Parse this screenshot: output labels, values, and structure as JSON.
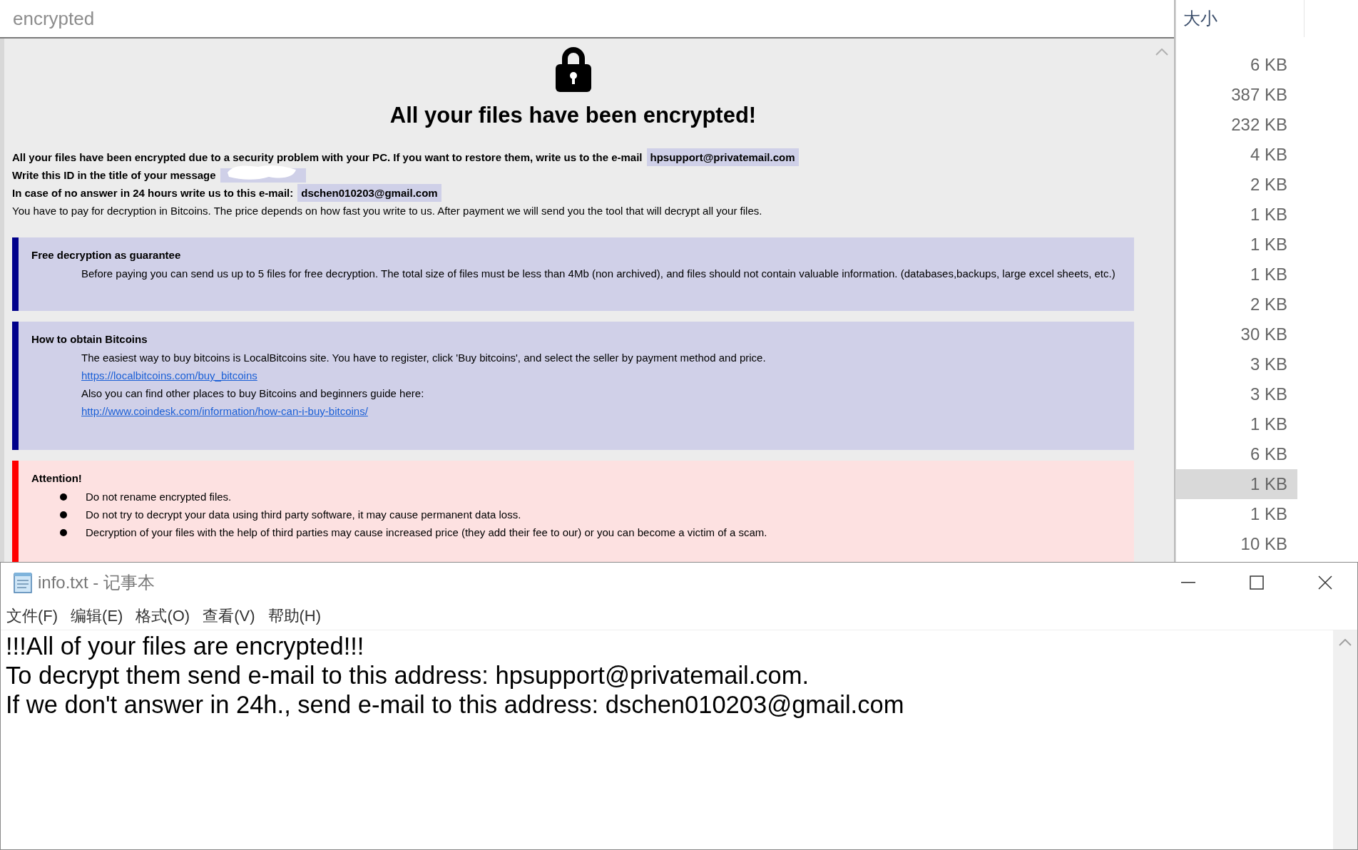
{
  "search": {
    "value": "encrypted"
  },
  "note": {
    "title": "All your files have been encrypted!",
    "intro": [
      {
        "text": "All your files have been encrypted due to a security problem with your PC. If you want to restore them, write us to the e-mail",
        "highlight": "hpsupport@privatemail.com",
        "bold": true
      },
      {
        "text": "Write this ID in the title of your message",
        "redacted": true,
        "bold": true
      },
      {
        "text": "In case of no answer in 24 hours write us to this e-mail:",
        "highlight": "dschen010203@gmail.com",
        "bold": true
      },
      {
        "text": "You have to pay for decryption in Bitcoins. The price depends on how fast you write to us. After payment we will send you the tool that will decrypt all your files.",
        "bold": false
      }
    ],
    "sections": [
      {
        "kind": "info",
        "heading": "Free decryption as guarantee",
        "lines": [
          {
            "kind": "text",
            "text": "Before paying you can send us up to 5 files for free decryption. The total size of files must be less than 4Mb (non archived), and files should not contain valuable information. (databases,backups, large excel sheets, etc.)"
          }
        ]
      },
      {
        "kind": "info",
        "heading": "How to obtain Bitcoins",
        "lines": [
          {
            "kind": "text",
            "text": "The easiest way to buy bitcoins is LocalBitcoins site. You have to register, click 'Buy bitcoins', and select the seller by payment method and price."
          },
          {
            "kind": "link",
            "text": "https://localbitcoins.com/buy_bitcoins"
          },
          {
            "kind": "text",
            "text": "Also you can find other places to buy Bitcoins and beginners guide here:"
          },
          {
            "kind": "link",
            "text": "http://www.coindesk.com/information/how-can-i-buy-bitcoins/"
          }
        ]
      },
      {
        "kind": "warning",
        "heading": "Attention!",
        "lines": [
          {
            "kind": "bullet",
            "text": "Do not rename encrypted files."
          },
          {
            "kind": "bullet",
            "text": "Do not try to decrypt your data using third party software, it may cause permanent data loss."
          },
          {
            "kind": "bullet",
            "text": "Decryption of your files with the help of third parties may cause increased price (they add their fee to our) or you can become a victim of a scam."
          }
        ]
      }
    ]
  },
  "explorer": {
    "column": "大小",
    "rows": [
      {
        "size": "6 KB",
        "selected": false
      },
      {
        "size": "387 KB",
        "selected": false
      },
      {
        "size": "232 KB",
        "selected": false
      },
      {
        "size": "4 KB",
        "selected": false
      },
      {
        "size": "2 KB",
        "selected": false
      },
      {
        "size": "1 KB",
        "selected": false
      },
      {
        "size": "1 KB",
        "selected": false
      },
      {
        "size": "1 KB",
        "selected": false
      },
      {
        "size": "2 KB",
        "selected": false
      },
      {
        "size": "30 KB",
        "selected": false
      },
      {
        "size": "3 KB",
        "selected": false
      },
      {
        "size": "3 KB",
        "selected": false
      },
      {
        "size": "1 KB",
        "selected": false
      },
      {
        "size": "6 KB",
        "selected": false
      },
      {
        "size": "1 KB",
        "selected": true
      },
      {
        "size": "1 KB",
        "selected": false
      },
      {
        "size": "10 KB",
        "selected": false
      }
    ]
  },
  "notepad": {
    "title": "info.txt - 记事本",
    "menu": [
      "文件(F)",
      "编辑(E)",
      "格式(O)",
      "查看(V)",
      "帮助(H)"
    ],
    "lines": [
      "!!!All of your files are encrypted!!!",
      "To decrypt them send e-mail to this address: hpsupport@privatemail.com.",
      "If we don't answer in 24h., send e-mail to this address: dschen010203@gmail.com"
    ]
  }
}
